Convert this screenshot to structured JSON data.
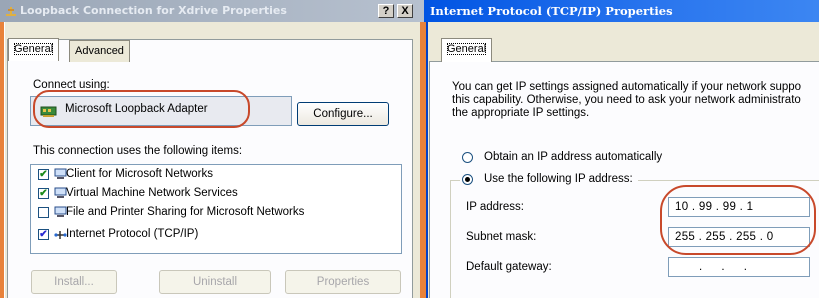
{
  "left_window": {
    "title": "Loopback Connection for Xdrive Properties",
    "help_btn": "?",
    "close_btn": "X",
    "tabs": [
      {
        "label": "General",
        "active": true
      },
      {
        "label": "Advanced",
        "active": false
      }
    ],
    "connect_using_label": "Connect using:",
    "adapter_name": "Microsoft Loopback Adapter",
    "configure_label": "Configure...",
    "items_label": "This connection uses the following items:",
    "items": [
      {
        "label": "Client for Microsoft Networks",
        "checked": true,
        "icon": "network-client-icon"
      },
      {
        "label": "Virtual Machine Network Services",
        "checked": true,
        "icon": "network-service-icon"
      },
      {
        "label": "File and Printer Sharing for Microsoft Networks",
        "checked": false,
        "icon": "file-printer-sharing-icon"
      },
      {
        "label": "Internet Protocol (TCP/IP)",
        "checked": true,
        "icon": "protocol-icon"
      }
    ],
    "buttons": {
      "install": "Install...",
      "uninstall": "Uninstall",
      "properties": "Properties"
    }
  },
  "right_window": {
    "title": "Internet Protocol (TCP/IP) Properties",
    "tab": "General",
    "description": [
      "You can get IP settings assigned automatically if your network suppo",
      "this capability. Otherwise, you need to ask your network administrato",
      "the appropriate IP settings."
    ],
    "radio_auto": "Obtain an IP address automatically",
    "radio_manual": "Use the following IP address:",
    "selected_radio": "manual",
    "fields": {
      "ip_label": "IP address:",
      "ip_value": "10 . 99 . 99 . 1",
      "subnet_label": "Subnet mask:",
      "subnet_value": "255 . 255 . 255 . 0",
      "gateway_label": "Default gateway:",
      "gateway_value": ". . ."
    }
  },
  "colors": {
    "annotation": "#c8492b",
    "background": "#e8823a",
    "active_title": "#0054e3"
  }
}
